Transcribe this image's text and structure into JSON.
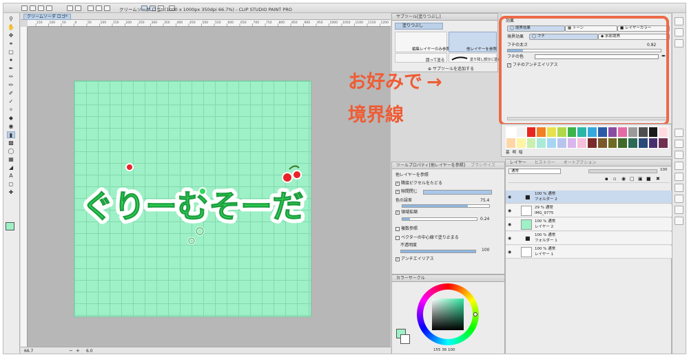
{
  "app": {
    "title": "クリームソーダ ロゴ* (1000 x 1000px 350dpi 66.7%) - CLIP STUDIO PAINT PRO",
    "doc_tab": "クリームソーダ ロゴ*",
    "zoom": "66.7",
    "status_coords": "6.0"
  },
  "ruler_ticks": [
    "150",
    "100",
    "50",
    "0",
    "50",
    "100",
    "150",
    "200",
    "250",
    "300",
    "350",
    "400",
    "450",
    "500",
    "550",
    "600",
    "650",
    "700",
    "750",
    "800",
    "850",
    "900",
    "950",
    "1000",
    "1050",
    "1100",
    "1150",
    "1200",
    "1250"
  ],
  "artwork_text": "ぐりーむそーだ",
  "subtool_panel": {
    "header": "サブツール[塗りつぶし]",
    "active_tab": "塗りつぶし",
    "items": [
      "編集レイヤーのみ参照",
      "他レイヤーを参照",
      "囲って塗る",
      "塗り残し部分に塗る"
    ],
    "add_label": "サブツールを追加する"
  },
  "effect_panel": {
    "header": "効果",
    "tabs": [
      "境界効果",
      "トーン",
      "レイヤーカラー"
    ],
    "boundary_label": "境界効果",
    "boundary_opts": [
      "フチ",
      "水彩境界"
    ],
    "edge_width_label": "フチの太さ",
    "edge_width_value": "0.82",
    "edge_width_fraction": 0.1,
    "edge_color_label": "フチの色",
    "antialias_label": "フチのアンチエイリアス"
  },
  "annotation": {
    "line1": "お好みで",
    "arrow": "→",
    "line2": "境界線"
  },
  "palette_tabs": [
    "基",
    "明",
    "暗"
  ],
  "palette_colors": [
    "#ffffff",
    "#f2f2f2",
    "#e8251f",
    "#f37f24",
    "#e9e14b",
    "#b1d84a",
    "#3db34a",
    "#2bb7a6",
    "#36a8e0",
    "#2b5aa9",
    "#8a4ca1",
    "#e56aa5",
    "#9a9a9a",
    "#505050",
    "#1a1a1a",
    "#ffdbe0",
    "#ffd6a5",
    "#fff4a6",
    "#c9f0b0",
    "#a9ead8",
    "#a7d6f5",
    "#b8c4f0",
    "#d9b7ee",
    "#f6c1dc",
    "#7a2b2b",
    "#7a5a2b",
    "#6e6b25",
    "#3f6a2b",
    "#2b6a55",
    "#2b4a7a",
    "#483070",
    "#70304f"
  ],
  "toolprop_panel": {
    "tabs": [
      "ツールプロパティ[他レイヤーを参照]",
      "ブラシサイズ"
    ],
    "subtitle": "他レイヤーを参照",
    "close_gap_label": "隣接ピクセルをたどる",
    "gap_label": "隙間閉じ",
    "color_margin_label": "色の誤差",
    "color_margin_value": "75.4",
    "color_margin_fraction": 0.754,
    "expand_label": "領域拡縮",
    "expand_value": "0.24",
    "expand_fraction": 0.1,
    "multi_ref_label": "複数参照",
    "vector_center_label": "ベクターの中心線で塗り止まる",
    "opacity_label": "不透明度",
    "opacity_value": "100",
    "opacity_fraction": 1.0,
    "antialias_label": "アンチエイリアス"
  },
  "layer_panel": {
    "tabs": [
      "レイヤー",
      "ヒストリー",
      "オートアクション"
    ],
    "blend_mode": "通常",
    "opacity": "100",
    "layers": [
      {
        "pct": "100 % 通常",
        "name": "フォルダー 2",
        "type": "folder",
        "selected": true
      },
      {
        "pct": "29 % 通常",
        "name": "IMG_9775",
        "type": "image",
        "selected": false
      },
      {
        "pct": "100 % 通常",
        "name": "レイヤー 2",
        "type": "fill",
        "selected": false
      },
      {
        "pct": "100 % 通常",
        "name": "フォルダー 1",
        "type": "folder",
        "selected": false
      },
      {
        "pct": "100 % 通常",
        "name": "レイヤー 1",
        "type": "blank",
        "selected": false
      }
    ]
  },
  "color_panel": {
    "header": "カラーサークル",
    "values": "155 36 100",
    "main_color": "#9ef0c6",
    "sub_color": "#ffffff"
  }
}
